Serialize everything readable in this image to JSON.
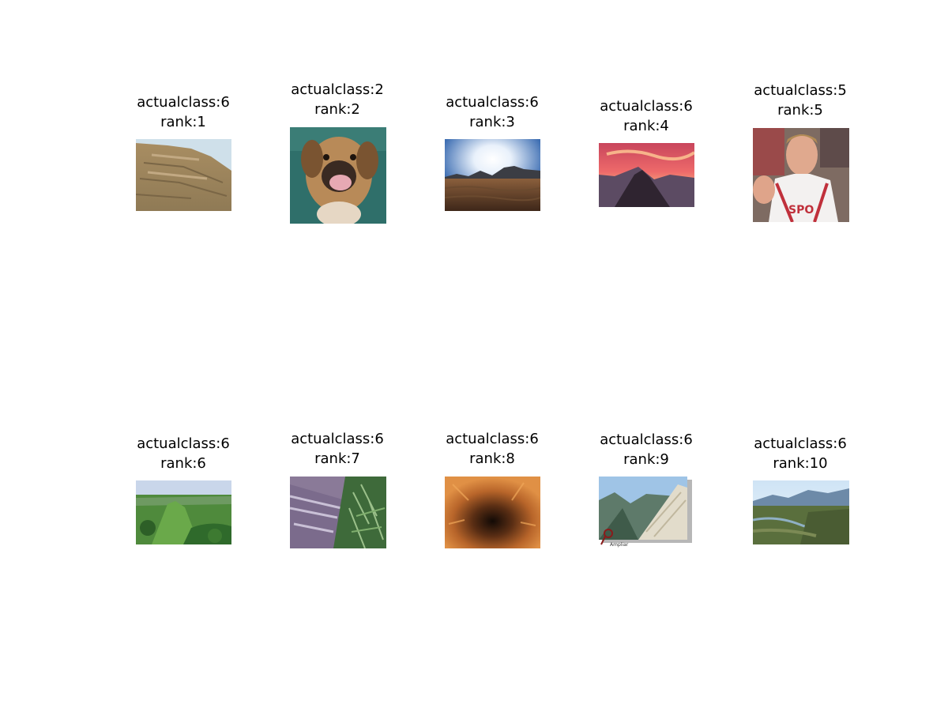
{
  "results": [
    {
      "actualclass_label": "actualclass:6",
      "rank_label": "rank:1",
      "image": "rocky-cliff-photo"
    },
    {
      "actualclass_label": "actualclass:2",
      "rank_label": "rank:2",
      "image": "dog-photo"
    },
    {
      "actualclass_label": "actualclass:6",
      "rank_label": "rank:3",
      "image": "desert-sun-photo"
    },
    {
      "actualclass_label": "actualclass:6",
      "rank_label": "rank:4",
      "image": "sunset-mountain-photo"
    },
    {
      "actualclass_label": "actualclass:5",
      "rank_label": "rank:5",
      "image": "basketball-player-photo"
    },
    {
      "actualclass_label": "actualclass:6",
      "rank_label": "rank:6",
      "image": "green-hills-photo"
    },
    {
      "actualclass_label": "actualclass:6",
      "rank_label": "rank:7",
      "image": "rock-and-palms-photo"
    },
    {
      "actualclass_label": "actualclass:6",
      "rank_label": "rank:8",
      "image": "cave-tunnel-photo"
    },
    {
      "actualclass_label": "actualclass:6",
      "rank_label": "rank:9",
      "image": "mountain-valley-photo"
    },
    {
      "actualclass_label": "actualclass:6",
      "rank_label": "rank:10",
      "image": "river-valley-photo"
    }
  ]
}
